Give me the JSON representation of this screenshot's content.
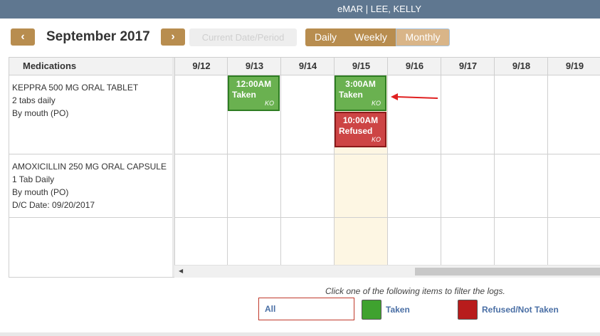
{
  "header": {
    "title": "eMAR | LEE, KELLY"
  },
  "toolbar": {
    "prev_label": "‹",
    "next_label": "›",
    "month_title": "September 2017",
    "current_label": "Current Date/Period",
    "views": [
      "Daily",
      "Weekly",
      "Monthly"
    ],
    "active_view": "Monthly"
  },
  "grid": {
    "medications_header": "Medications",
    "days": [
      "9/12",
      "9/13",
      "9/14",
      "9/15",
      "9/16",
      "9/17",
      "9/18",
      "9/19"
    ],
    "highlight_day": "9/15",
    "medications": [
      {
        "name": "KEPPRA 500 MG ORAL TABLET",
        "dose": "2 tabs daily",
        "route": "By mouth (PO)",
        "dc": ""
      },
      {
        "name": "AMOXICILLIN 250 MG ORAL CAPSULE",
        "dose": "1 Tab Daily",
        "route": "By mouth (PO)",
        "dc": "D/C Date: 09/20/2017"
      }
    ],
    "logs": [
      {
        "day": "9/13",
        "time": "12:00AM",
        "status": "Taken",
        "initials": "KO"
      },
      {
        "day": "9/15",
        "time": "3:00AM",
        "status": "Taken",
        "initials": "KO"
      },
      {
        "day": "9/15",
        "time": "10:00AM",
        "status": "Refused",
        "initials": "KO"
      }
    ]
  },
  "filter": {
    "hint": "Click one of the following items to filter the logs.",
    "all_label": "All",
    "taken_label": "Taken",
    "refused_label": "Refused/Not Taken"
  },
  "colors": {
    "title_bar": "#5f7790",
    "accent": "#b88d4f",
    "taken": "#3fa22f",
    "refused": "#b81c1c",
    "annotation_arrow": "#e02020"
  }
}
